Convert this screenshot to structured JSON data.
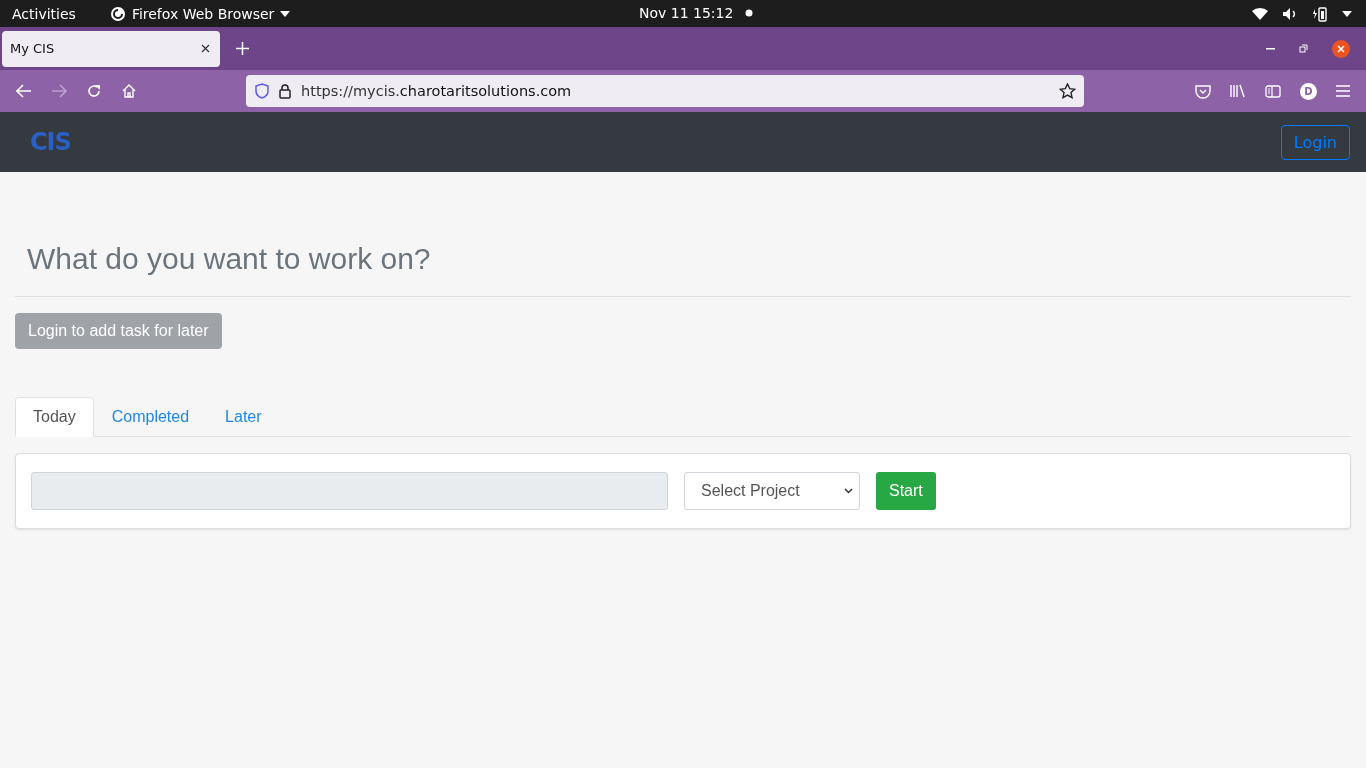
{
  "system_bar": {
    "activities": "Activities",
    "app_menu": "Firefox Web Browser",
    "clock": "Nov 11  15:12"
  },
  "browser": {
    "tabs": [
      {
        "title": "My CIS",
        "selected": true
      }
    ],
    "url_prefix": "https://mycis.",
    "url_domain": "charotaritsolutions.com",
    "profile_initial": "D"
  },
  "site_nav": {
    "logo": "CIS",
    "login_button": "Login"
  },
  "page": {
    "heading": "What do you want to work on?",
    "add_later_button": "Login to add task for later",
    "tabs": [
      {
        "label": "Today",
        "selected": true
      },
      {
        "label": "Completed",
        "selected": false
      },
      {
        "label": "Later",
        "selected": false
      }
    ],
    "task_input": {
      "disabled": true
    },
    "project_select": {
      "placeholder": "Select Project"
    },
    "start_button": "Start"
  }
}
